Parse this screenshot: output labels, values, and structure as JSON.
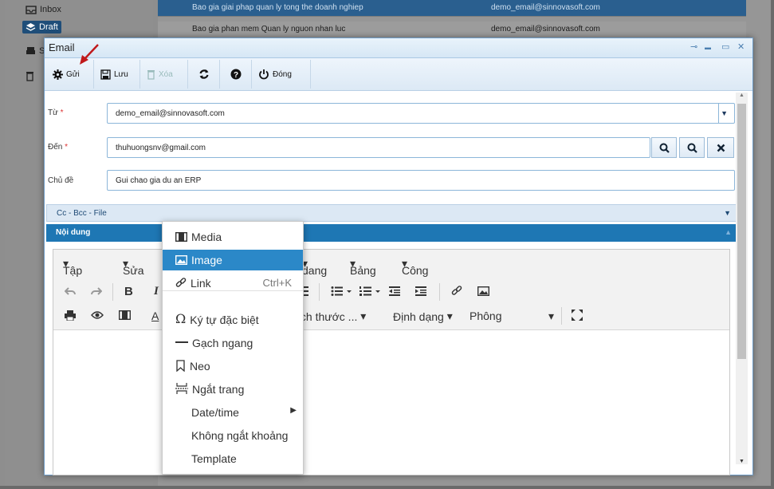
{
  "background": {
    "folders": [
      {
        "label": "Inbox"
      },
      {
        "label": "Draft"
      },
      {
        "label": "S"
      }
    ],
    "rows": [
      {
        "subject": "Bao gia giai phap quan ly tong the doanh nghiep",
        "email": "demo_email@sinnovasoft.com"
      },
      {
        "subject": "Bao gia phan mem Quan ly nguon nhan luc",
        "email": "demo_email@sinnovasoft.com"
      }
    ]
  },
  "dialog": {
    "title": "Email",
    "window_controls": {
      "pin": "⊸",
      "minimize": "▬",
      "maximize": "▭",
      "close": "✕"
    },
    "toolbar": {
      "send": "Gửi",
      "save": "Lưu",
      "delete": "Xóa",
      "close": "Đóng"
    },
    "form": {
      "from_label": "Từ",
      "from_value": "demo_email@sinnovasoft.com",
      "to_label": "Đến",
      "to_value": "thuhuongsnv@gmail.com",
      "subject_label": "Chủ đề",
      "subject_value": "Gui chao gia du an ERP",
      "required_mark": "*"
    },
    "cc_band": "Cc - Bcc - File",
    "content_band": "Nội dung"
  },
  "editor": {
    "menu": [
      "Tập tin",
      "Sửa",
      "dang",
      "Bảng",
      "Công cụ"
    ],
    "font_size_label": "ích thước ...",
    "format_label": "Định dạng",
    "font_label": "Phông"
  },
  "insert_menu": {
    "items": [
      {
        "label": "Media",
        "icon": "media-icon"
      },
      {
        "label": "Image",
        "icon": "image-icon",
        "active": true
      },
      {
        "label": "Link",
        "icon": "link-icon",
        "shortcut": "Ctrl+K"
      },
      {
        "label": "Ký tự đặc biệt",
        "icon": "omega-icon"
      },
      {
        "label": "Gạch ngang",
        "icon": "hr-icon"
      },
      {
        "label": "Neo",
        "icon": "bookmark-icon"
      },
      {
        "label": "Ngắt trang",
        "icon": "pagebreak-icon"
      },
      {
        "label": "Date/time",
        "submenu": true
      },
      {
        "label": "Không ngắt khoảng"
      },
      {
        "label": "Template"
      }
    ]
  },
  "colors": {
    "accent": "#1e77b4",
    "active_item": "#2b88c8",
    "arrow": "#c0181a"
  }
}
